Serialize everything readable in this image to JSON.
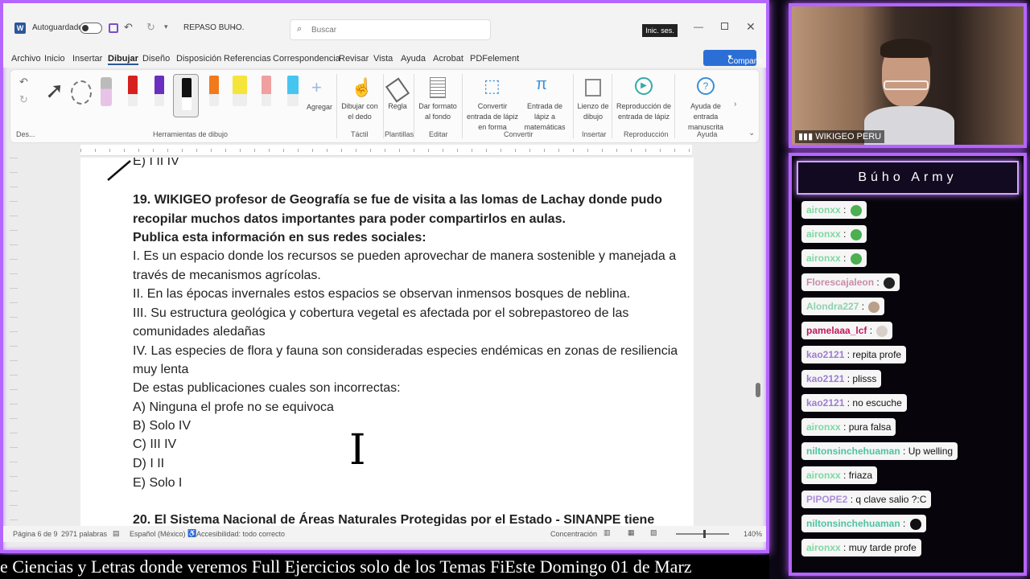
{
  "word": {
    "autosave_label": "Autoguardado",
    "doc_title": "REPASO BUHO.",
    "search_placeholder": "Buscar",
    "signin": "Inic. ses.",
    "share": "Compartir",
    "menu": [
      "Archivo",
      "Inicio",
      "Insertar",
      "Dibujar",
      "Diseño",
      "Disposición",
      "Referencias",
      "Correspondencia",
      "Revisar",
      "Vista",
      "Ayuda",
      "Acrobat",
      "PDFelement"
    ],
    "ribbon": {
      "add_pen": "Agregar",
      "draw_finger": "Dibujar con el dedo",
      "ruler": "Regla",
      "format_bg": "Dar formato al fondo",
      "ink_to_shape": "Convertir entrada de lápiz en forma",
      "ink_to_math": "Entrada de lápiz a matemáticas",
      "canvas": "Lienzo de dibujo",
      "replay": "Reproducción de entrada de lápiz",
      "ink_help": "Ayuda de entrada manuscrita",
      "groups": {
        "drawing_tools": "Herramientas de dibujo",
        "touch": "Táctil",
        "templates": "Plantillas",
        "edit": "Editar",
        "convert": "Convertir",
        "insert": "Insertar",
        "replay": "Reproducción",
        "help": "Ayuda",
        "undo": "Des..."
      }
    },
    "doc": {
      "prev_line": "E) I II IV",
      "q19_l1": "19. WIKIGEO profesor de Geografía se fue de visita a las lomas de Lachay donde pudo",
      "q19_l2": "recopilar muchos datos importantes para poder compartirlos en aulas.",
      "q19_l3": "Publica esta información en sus redes sociales:",
      "i1": "I. Es un espacio donde los recursos se pueden aprovechar de manera sostenible y manejada a",
      "i2": "través de mecanismos agrícolas.",
      "ii": "II. En las épocas invernales estos espacios se observan inmensos bosques de neblina.",
      "iii1": "III. Su estructura geológica y cobertura vegetal es afectada por el sobrepastoreo de las",
      "iii2": "comunidades aledañas",
      "iv1": "IV. Las especies de flora y fauna son consideradas especies endémicas en zonas de resiliencia",
      "iv2": "muy lenta",
      "ask": "De estas publicaciones cuales son incorrectas:",
      "a": "A) Ninguna el profe no se equivoca",
      "b": "B) Solo IV",
      "c": "C) III IV",
      "d": "D) I II",
      "e": "E) Solo I",
      "q20": "20. El Sistema Nacional de Áreas Naturales Protegidas por el Estado - SINANPE tiene"
    },
    "status": {
      "page": "Página 6 de 9",
      "words": "2971 palabras",
      "lang": "Español (México)",
      "access": "Accesibilidad: todo correcto",
      "focus": "Concentración",
      "zoom": "140%"
    }
  },
  "cam": {
    "name": "WIKIGEO PERU"
  },
  "chat": {
    "title": "Búho Army",
    "messages": [
      {
        "user": "aironxx",
        "text": "",
        "emoji": "#4caf50",
        "ucolor": "#7dd8a0"
      },
      {
        "user": "aironxx",
        "text": "",
        "emoji": "#4caf50",
        "ucolor": "#7dd8a0"
      },
      {
        "user": "aironxx",
        "text": "",
        "emoji": "#4caf50",
        "ucolor": "#7dd8a0"
      },
      {
        "user": "Florescajaleon",
        "text": "",
        "emoji": "#222222",
        "ucolor": "#c98ba8"
      },
      {
        "user": "Alondra227",
        "text": "",
        "emoji": "#b9a08a",
        "ucolor": "#8fd0b0"
      },
      {
        "user": "pamelaaa_lcf",
        "text": "",
        "emoji": "#d8d0c8",
        "ucolor": "#c2185b"
      },
      {
        "user": "kao2121",
        "text": "repita profe",
        "emoji": "",
        "ucolor": "#9c7cd0"
      },
      {
        "user": "kao2121",
        "text": "plisss",
        "emoji": "",
        "ucolor": "#9c7cd0"
      },
      {
        "user": "kao2121",
        "text": "no escuche",
        "emoji": "",
        "ucolor": "#9c7cd0"
      },
      {
        "user": "aironxx",
        "text": "pura falsa",
        "emoji": "",
        "ucolor": "#7dd8a0"
      },
      {
        "user": "niltonsinchehuaman",
        "text": "Up welling",
        "emoji": "",
        "ucolor": "#4fc3a1"
      },
      {
        "user": "aironxx",
        "text": "friaza",
        "emoji": "",
        "ucolor": "#7dd8a0"
      },
      {
        "user": "PIPOPE2",
        "text": "q clave salio ?:C",
        "emoji": "",
        "ucolor": "#a98fd8"
      },
      {
        "user": "niltonsinchehuaman",
        "text": "",
        "emoji": "#111111",
        "ucolor": "#4fc3a1"
      },
      {
        "user": "aironxx",
        "text": "muy tarde profe",
        "emoji": "",
        "ucolor": "#7dd8a0"
      }
    ]
  },
  "ticker": "e Ciencias y Letras donde veremos Full Ejercicios solo de los Temas FiEste Domingo 01 de Marz"
}
